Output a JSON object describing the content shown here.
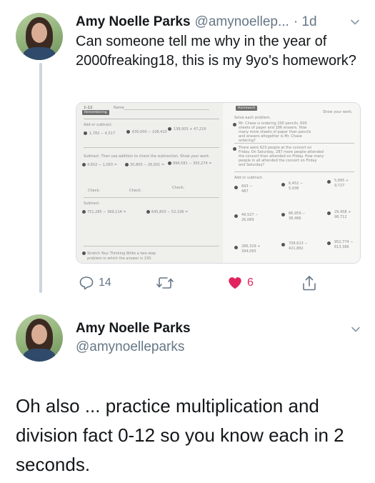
{
  "tweet1": {
    "author_name": "Amy Noelle Parks",
    "author_handle": "@amynoellep...",
    "time": "· 1d",
    "text": "Can someone tell me why in the year of 2000freaking18, this is my 9yo's homework?",
    "media": {
      "icon": "worksheet-photo",
      "left_page": {
        "lesson": "1-12",
        "tag": "Remembering",
        "name_label": "Name",
        "section1": "Add or subtract.",
        "p1": "1,782 − 4,517",
        "p2": "630,000 − 108,410",
        "p3": "138,903 + 47,216",
        "section2": "Subtract. Then use addition to check the subtraction. Show your work.",
        "p4": "4,652 − 1,093 =",
        "p5": "30,800 − 26,931 =",
        "p6": "896,581 − 355,274 =",
        "check_label": "Check:",
        "section3": "Subtract.",
        "p7": "751,285 − 369,114 =",
        "p8": "645,803 − 52,196 =",
        "stretch": "Stretch Your Thinking  Write a two-step problem in which the answer is 130."
      },
      "right_page": {
        "header": "Homework",
        "show_work": "Show your work.",
        "section1": "Solve each problem.",
        "q1": "Mr. Chase is ordering 200 pencils, 600 sheets of paper and 186 erasers. How many more sheets of paper than pencils and erasers altogether is Mr. Chase ordering?",
        "q2": "There were 623 people at the concert on Friday. On Saturday, 287 more people attended the concert than attended on Friday. How many people in all attended the concert on Friday and Saturday?",
        "section2": "Add or subtract.",
        "r1": "693 − 487",
        "r2": "6,452 − 5,938",
        "r3": "5,895 + 9,727",
        "r4": "49,527 − 26,089",
        "r5": "86,959 − 38,486",
        "r6": "29,458 + 98,712",
        "r7": "286,329 + 394,065",
        "r8": "708,623 − 421,882",
        "r9": "952,774 − 613,386"
      }
    },
    "actions": {
      "reply_count": "14",
      "retweet_count": "",
      "like_count": "6",
      "reply_icon": "reply-icon",
      "retweet_icon": "retweet-icon",
      "like_icon": "heart-icon",
      "share_icon": "share-icon"
    }
  },
  "tweet2": {
    "author_name": "Amy Noelle Parks",
    "author_handle": "@amynoelleparks",
    "text": "Oh also ... practice multiplication and division fact 0-12 so you know each in 2 seconds."
  },
  "colors": {
    "text": "#14171a",
    "secondary": "#657786",
    "like": "#e0245e",
    "thread_line": "#ccd6dd"
  }
}
